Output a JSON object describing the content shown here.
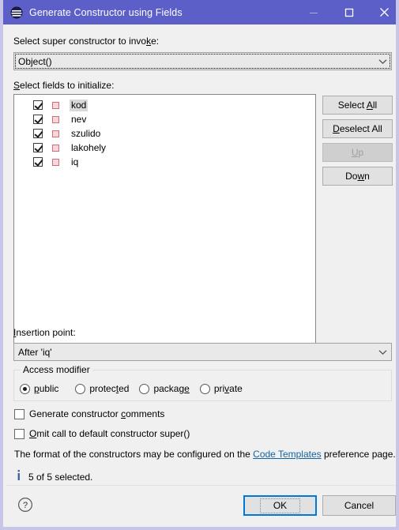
{
  "window": {
    "title": "Generate Constructor using Fields",
    "icon": "eclipse-java-icon",
    "titlebar_color": "#5b5fc7",
    "controls": {
      "minimize": "minimize-icon",
      "maximize": "maximize-icon",
      "close": "close-icon"
    }
  },
  "super_constructor": {
    "label_pre": "Select super constructor to invo",
    "label_mnemonic": "k",
    "label_post": "e:",
    "value": "Object()",
    "dropdown_icon": "chevron-down-icon"
  },
  "fields_section": {
    "label_mnemonic": "S",
    "label_post": "elect fields to initialize:",
    "items": [
      {
        "name": "kod",
        "checked": true,
        "selected": true,
        "icon": "private-field-icon"
      },
      {
        "name": "nev",
        "checked": true,
        "selected": false,
        "icon": "private-field-icon"
      },
      {
        "name": "szulido",
        "checked": true,
        "selected": false,
        "icon": "private-field-icon"
      },
      {
        "name": "lakohely",
        "checked": true,
        "selected": false,
        "icon": "private-field-icon"
      },
      {
        "name": "iq",
        "checked": true,
        "selected": false,
        "icon": "private-field-icon"
      }
    ]
  },
  "side_buttons": [
    {
      "pre": "Select ",
      "mnemonic": "A",
      "post": "ll",
      "enabled": true,
      "name": "select-all-button"
    },
    {
      "pre": "",
      "mnemonic": "D",
      "post": "eselect All",
      "enabled": true,
      "name": "deselect-all-button"
    },
    {
      "pre": "",
      "mnemonic": "U",
      "post": "p",
      "enabled": false,
      "name": "move-up-button"
    },
    {
      "pre": "Do",
      "mnemonic": "w",
      "post": "n",
      "enabled": true,
      "name": "move-down-button"
    }
  ],
  "insertion_point": {
    "label_mnemonic": "I",
    "label_post": "nsertion point:",
    "value": "After 'iq'",
    "dropdown_icon": "chevron-down-icon"
  },
  "access_modifier": {
    "group_title": "Access modifier",
    "options": [
      {
        "pre": "",
        "mnemonic": "p",
        "post": "ublic",
        "selected": true
      },
      {
        "pre": "protec",
        "mnemonic": "t",
        "post": "ed",
        "selected": false
      },
      {
        "pre": "packag",
        "mnemonic": "e",
        "post": "",
        "selected": false
      },
      {
        "pre": "pri",
        "mnemonic": "v",
        "post": "ate",
        "selected": false
      }
    ]
  },
  "options": [
    {
      "pre": "Generate constructor ",
      "mnemonic": "c",
      "post": "omments",
      "checked": false,
      "name": "generate-comments-checkbox"
    },
    {
      "pre": "",
      "mnemonic": "O",
      "post": "mit call to default constructor super()",
      "checked": false,
      "name": "omit-super-call-checkbox"
    }
  ],
  "note": {
    "before_link": "The format of the constructors may be configured on the ",
    "link_text": "Code Templates",
    "after_link": " preference page.",
    "link_color": "#1464a0"
  },
  "status": {
    "icon": "info-icon",
    "text": "5 of 5 selected."
  },
  "footer": {
    "help_icon": "help-question-icon",
    "ok_label": "OK",
    "cancel_label": "Cancel",
    "ok_focus_color": "#0078d7"
  }
}
